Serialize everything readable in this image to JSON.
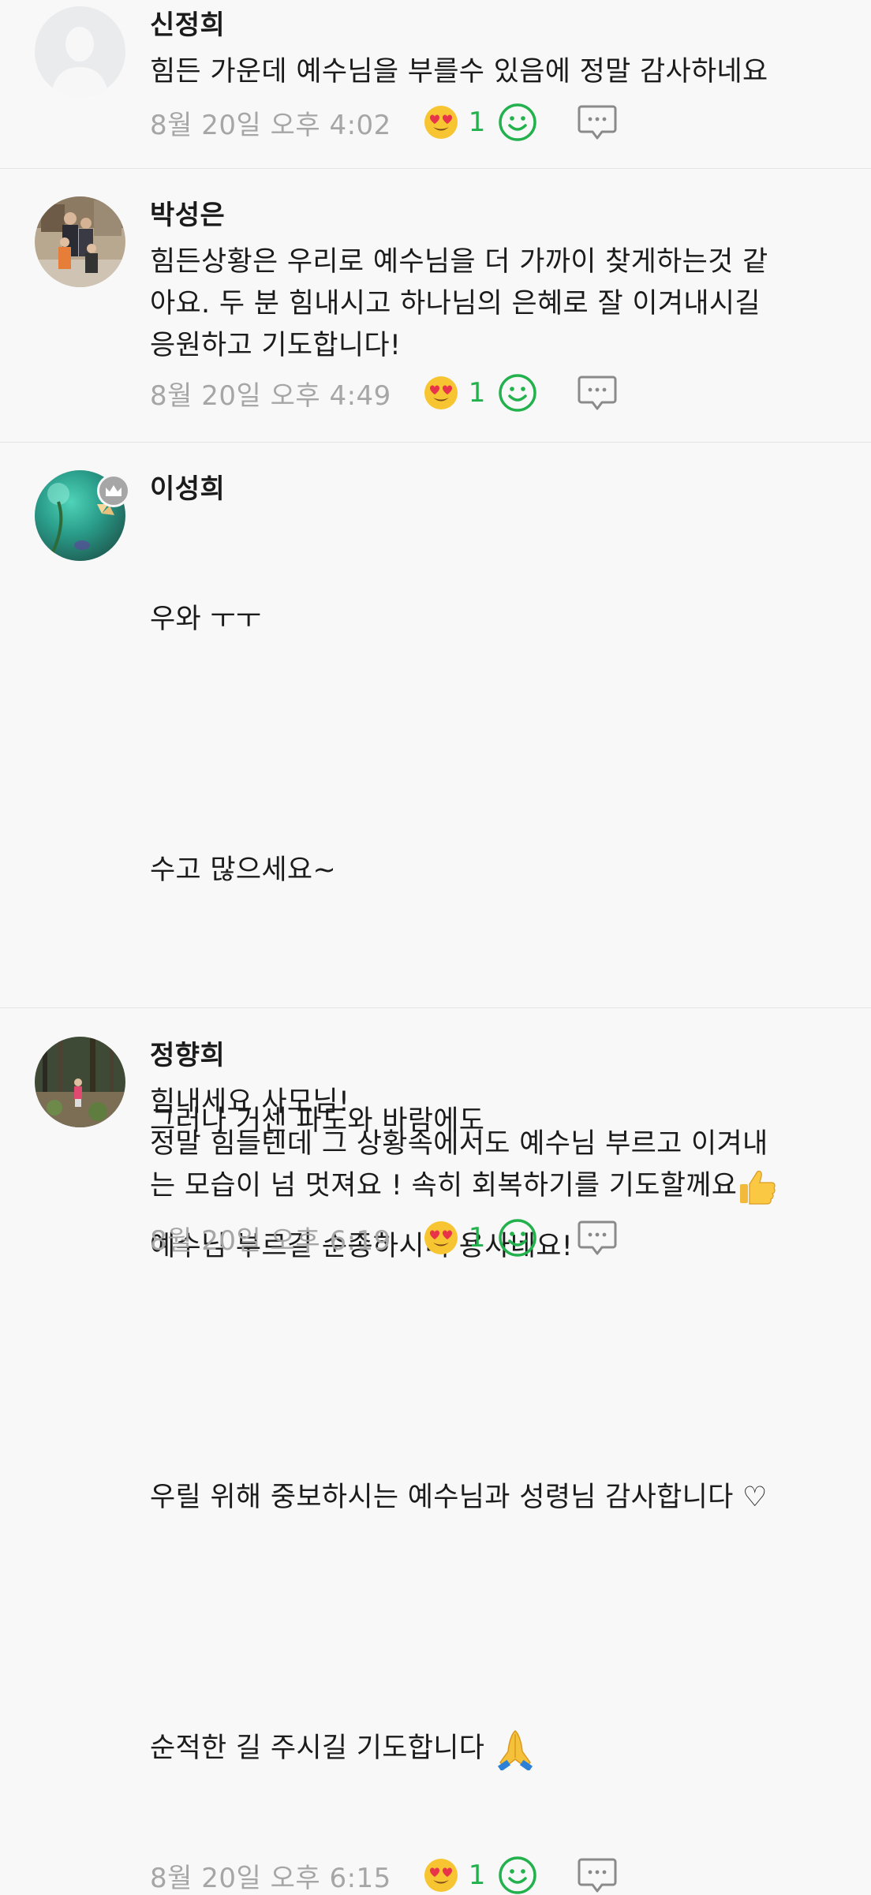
{
  "comments": [
    {
      "name": "신정희",
      "text": "힘든 가운데 예수님을 부를수 있음에 정말 감사하네요",
      "time": "8월 20일 오후 4:02",
      "reaction_count": "1"
    },
    {
      "name": "박성은",
      "text": "힘든상황은 우리로 예수님을 더 가까이 찾게하는것 같\n아요. 두 분 힘내시고 하나님의 은혜로 잘 이겨내시길\n응원하고 기도합니다!",
      "time": "8월 20일 오후 4:49",
      "reaction_count": "1"
    },
    {
      "name": "이성희",
      "text_lines": [
        "우와 ㅜㅜ",
        "",
        "수고 많으세요~",
        "",
        "그러나 거센 파도와 바람에도",
        "예수님 부르길 순종하시니 용사네요!",
        "",
        "우릴 위해 중보하시는 예수님과 성령님 감사합니다 ♡",
        "",
        "순적한 길 주시길 기도합니다"
      ],
      "time": "8월 20일 오후 6:15",
      "reaction_count": "1",
      "badge_icon": "crown-icon"
    },
    {
      "name": "정향희",
      "text": "힘내세요 사모님!\n정말 힘들텐데 그 상황속에서도 예수님 부르고 이겨내\n는 모습이 넘 멋져요 ! 속히 회복하기를 기도할께요",
      "time": "8월 20일 오후 6:19",
      "reaction_count": "1"
    }
  ],
  "icons": {
    "reaction": "heart-eyes-emoji-icon",
    "add_reaction": "smile-icon",
    "reply": "reply-bubble-icon"
  },
  "colors": {
    "accent_green": "#22b14c",
    "meta_gray": "#a6a6a6",
    "background": "#f8f8f8"
  }
}
